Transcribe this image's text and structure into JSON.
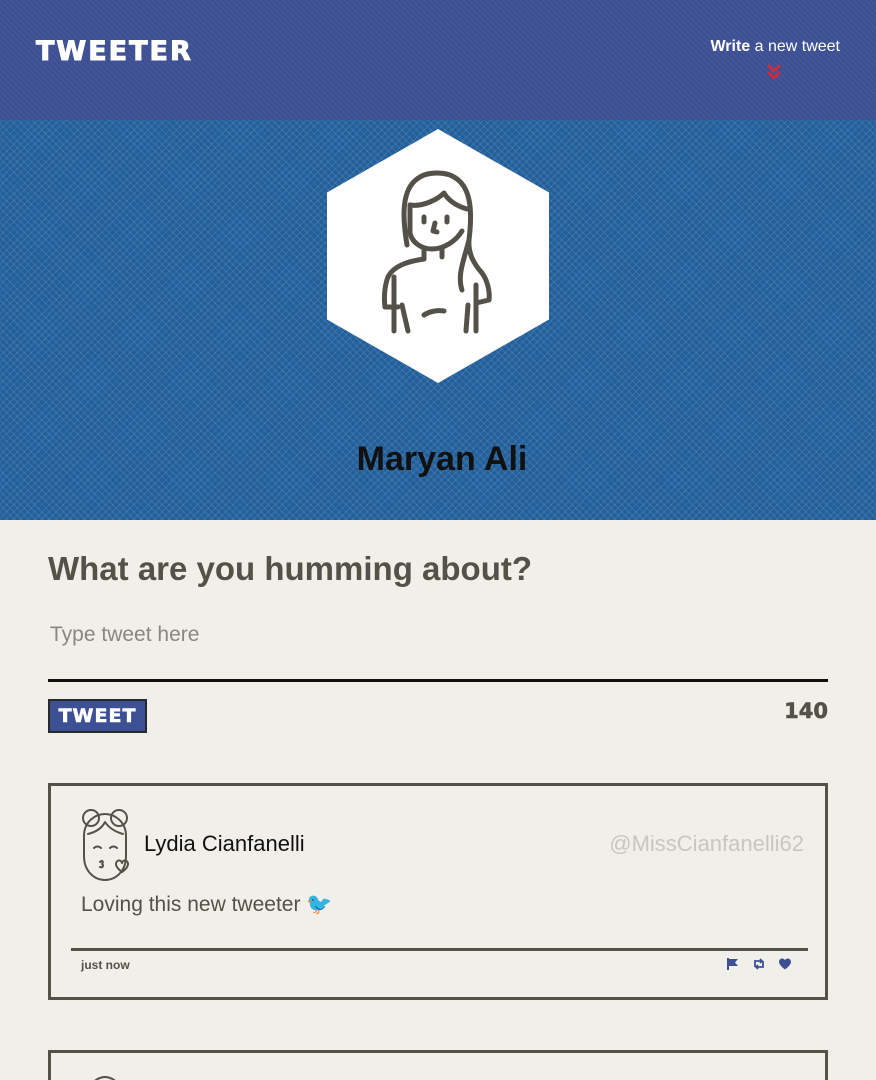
{
  "nav": {
    "logo": "Tweeter",
    "write_bold": "Write",
    "write_rest": " a new tweet",
    "chevron_icon": "double-chevron-down-icon",
    "chevron_color": "#e0262f"
  },
  "profile": {
    "name": "Maryan Ali",
    "avatar_icon": "woman-avatar-icon"
  },
  "compose": {
    "title": "What are you humming about?",
    "placeholder": "Type tweet here",
    "button_label": "Tweet",
    "counter": "140"
  },
  "tweets": [
    {
      "author": "Lydia Cianfanelli",
      "handle": "@MissCianfanelli62",
      "text": "Loving this new tweeter 🐦",
      "time": "just now",
      "actions": [
        "flag-icon",
        "retweet-icon",
        "heart-icon"
      ]
    }
  ],
  "colors": {
    "nav_bg": "#3e5094",
    "header_bg": "#23609b",
    "page_bg": "#f1efe9",
    "text": "#545149",
    "accent": "#3e5094"
  }
}
